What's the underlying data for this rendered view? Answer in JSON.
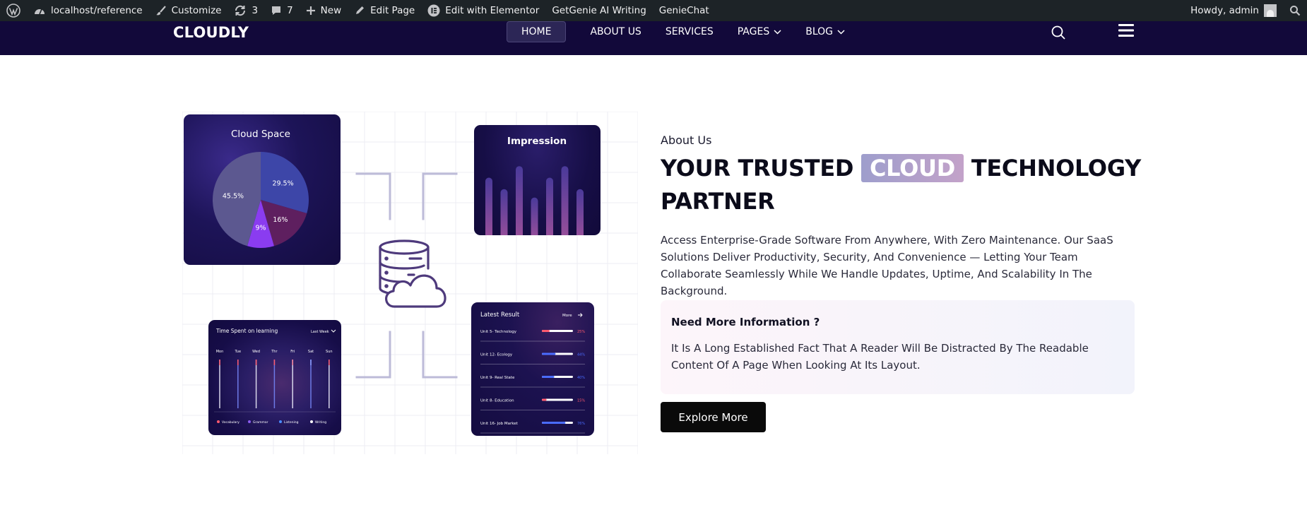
{
  "admin_bar": {
    "site_link": "localhost/reference",
    "customize": "Customize",
    "updates_count": "3",
    "comments_count": "7",
    "new_label": "New",
    "edit_page": "Edit Page",
    "edit_elementor": "Edit with Elementor",
    "getgenie": "GetGenie AI Writing",
    "geniechat": "GenieChat",
    "howdy": "Howdy, admin"
  },
  "header": {
    "logo": "CLOUDLY",
    "nav": [
      {
        "label": "HOME",
        "active": true
      },
      {
        "label": "ABOUT US"
      },
      {
        "label": "SERVICES"
      },
      {
        "label": "PAGES",
        "dropdown": true
      },
      {
        "label": "BLOG",
        "dropdown": true
      }
    ]
  },
  "illustration": {
    "cloud_space": {
      "title": "Cloud Space",
      "slices": [
        {
          "label": "29.5%",
          "value": 29.5,
          "color": "#3d46a8"
        },
        {
          "label": "16%",
          "value": 16,
          "color": "#5e1f5f"
        },
        {
          "label": "9%",
          "value": 9,
          "color": "#8a3cf0"
        },
        {
          "label": "45.5%",
          "value": 45.5,
          "color": "#5c5890"
        }
      ]
    },
    "impression": {
      "title": "Impression",
      "bars": [
        0.55,
        0.44,
        0.66,
        0.36,
        0.55,
        0.66,
        0.44
      ]
    },
    "time_spent": {
      "title": "Time Spent on learning",
      "range": "Last Week",
      "days": [
        "Mon",
        "Tue",
        "Wed",
        "Thr",
        "Fri",
        "Sat",
        "Sun"
      ],
      "legend": [
        {
          "label": "Vocabulary",
          "color": "#ff5a6e"
        },
        {
          "label": "Grammar",
          "color": "#8a5cf0"
        },
        {
          "label": "Listening",
          "color": "#4a8cff"
        },
        {
          "label": "Writing",
          "color": "#ffffff"
        }
      ]
    },
    "latest_result": {
      "title": "Latest Result",
      "more": "More",
      "rows": [
        {
          "label": "Unit 5- Technology",
          "percent": "25%",
          "value": 0.25,
          "color": "#ff5a6e"
        },
        {
          "label": "Unit 12- Ecology",
          "percent": "44%",
          "value": 0.44,
          "color": "#4a6cff"
        },
        {
          "label": "Unit 9- Real State",
          "percent": "40%",
          "value": 0.4,
          "color": "#4a6cff"
        },
        {
          "label": "Unit 8- Education",
          "percent": "15%",
          "value": 0.15,
          "color": "#ff5a6e"
        },
        {
          "label": "Unit 16- Job Market",
          "percent": "76%",
          "value": 0.76,
          "color": "#4a6cff"
        }
      ]
    }
  },
  "about": {
    "eyebrow": "About Us",
    "headline_before": "YOUR TRUSTED",
    "headline_highlight": "CLOUD",
    "headline_after": "TECHNOLOGY PARTNER",
    "description": "Access Enterprise-Grade Software From Anywhere, With Zero Maintenance. Our SaaS Solutions Deliver Productivity, Security, And Convenience — Letting Your Team Collaborate Seamlessly While We Handle Updates, Uptime, And Scalability In The Background.",
    "info_title": "Need More Information ?",
    "info_text": "It Is A Long Established Fact That A Reader Will Be Distracted By The Readable Content Of A Page When Looking At Its Layout.",
    "cta": "Explore More"
  }
}
